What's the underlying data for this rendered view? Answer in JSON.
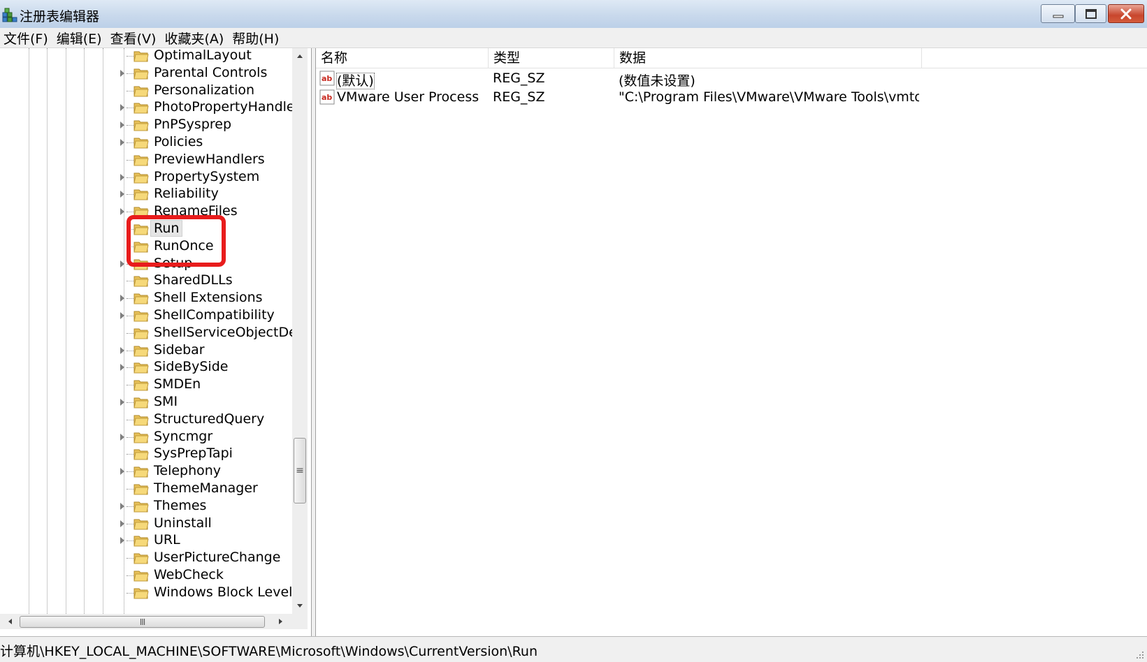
{
  "window": {
    "title": "注册表编辑器",
    "accent_colors": {
      "titlebar": "#c9d9ec",
      "close_button": "#c8462d",
      "annotation": "#e81c1c"
    }
  },
  "menu": [
    "文件(F)",
    "编辑(E)",
    "查看(V)",
    "收藏夹(A)",
    "帮助(H)"
  ],
  "tree": {
    "items": [
      {
        "label": "OptimalLayout",
        "expandable": false
      },
      {
        "label": "Parental Controls",
        "expandable": true
      },
      {
        "label": "Personalization",
        "expandable": false
      },
      {
        "label": "PhotoPropertyHandler",
        "expandable": true
      },
      {
        "label": "PnPSysprep",
        "expandable": true
      },
      {
        "label": "Policies",
        "expandable": true
      },
      {
        "label": "PreviewHandlers",
        "expandable": false
      },
      {
        "label": "PropertySystem",
        "expandable": true
      },
      {
        "label": "Reliability",
        "expandable": true
      },
      {
        "label": "RenameFiles",
        "expandable": true
      },
      {
        "label": "Run",
        "expandable": false,
        "selected": true
      },
      {
        "label": "RunOnce",
        "expandable": false
      },
      {
        "label": "Setup",
        "expandable": true
      },
      {
        "label": "SharedDLLs",
        "expandable": false
      },
      {
        "label": "Shell Extensions",
        "expandable": true
      },
      {
        "label": "ShellCompatibility",
        "expandable": true
      },
      {
        "label": "ShellServiceObjectDela",
        "expandable": false
      },
      {
        "label": "Sidebar",
        "expandable": true
      },
      {
        "label": "SideBySide",
        "expandable": true
      },
      {
        "label": "SMDEn",
        "expandable": false
      },
      {
        "label": "SMI",
        "expandable": true
      },
      {
        "label": "StructuredQuery",
        "expandable": false
      },
      {
        "label": "Syncmgr",
        "expandable": true
      },
      {
        "label": "SysPrepTapi",
        "expandable": false
      },
      {
        "label": "Telephony",
        "expandable": true
      },
      {
        "label": "ThemeManager",
        "expandable": false
      },
      {
        "label": "Themes",
        "expandable": true
      },
      {
        "label": "Uninstall",
        "expandable": true
      },
      {
        "label": "URL",
        "expandable": true
      },
      {
        "label": "UserPictureChange",
        "expandable": false
      },
      {
        "label": "WebCheck",
        "expandable": false
      },
      {
        "label": "Windows Block Level B",
        "expandable": false
      }
    ]
  },
  "list": {
    "columns": [
      "名称",
      "类型",
      "数据"
    ],
    "rows": [
      {
        "name": "(默认)",
        "type": "REG_SZ",
        "data": "(数值未设置)",
        "icon": "string-value-icon",
        "focused": true
      },
      {
        "name": "VMware User Process",
        "type": "REG_SZ",
        "data": "\"C:\\Program Files\\VMware\\VMware Tools\\vmto...",
        "icon": "string-value-icon",
        "focused": false
      }
    ]
  },
  "status": {
    "path": "计算机\\HKEY_LOCAL_MACHINE\\SOFTWARE\\Microsoft\\Windows\\CurrentVersion\\Run"
  },
  "scrollbars": {
    "vertical_thumb_glyph": "≡",
    "horizontal_thumb_glyph": "III"
  }
}
